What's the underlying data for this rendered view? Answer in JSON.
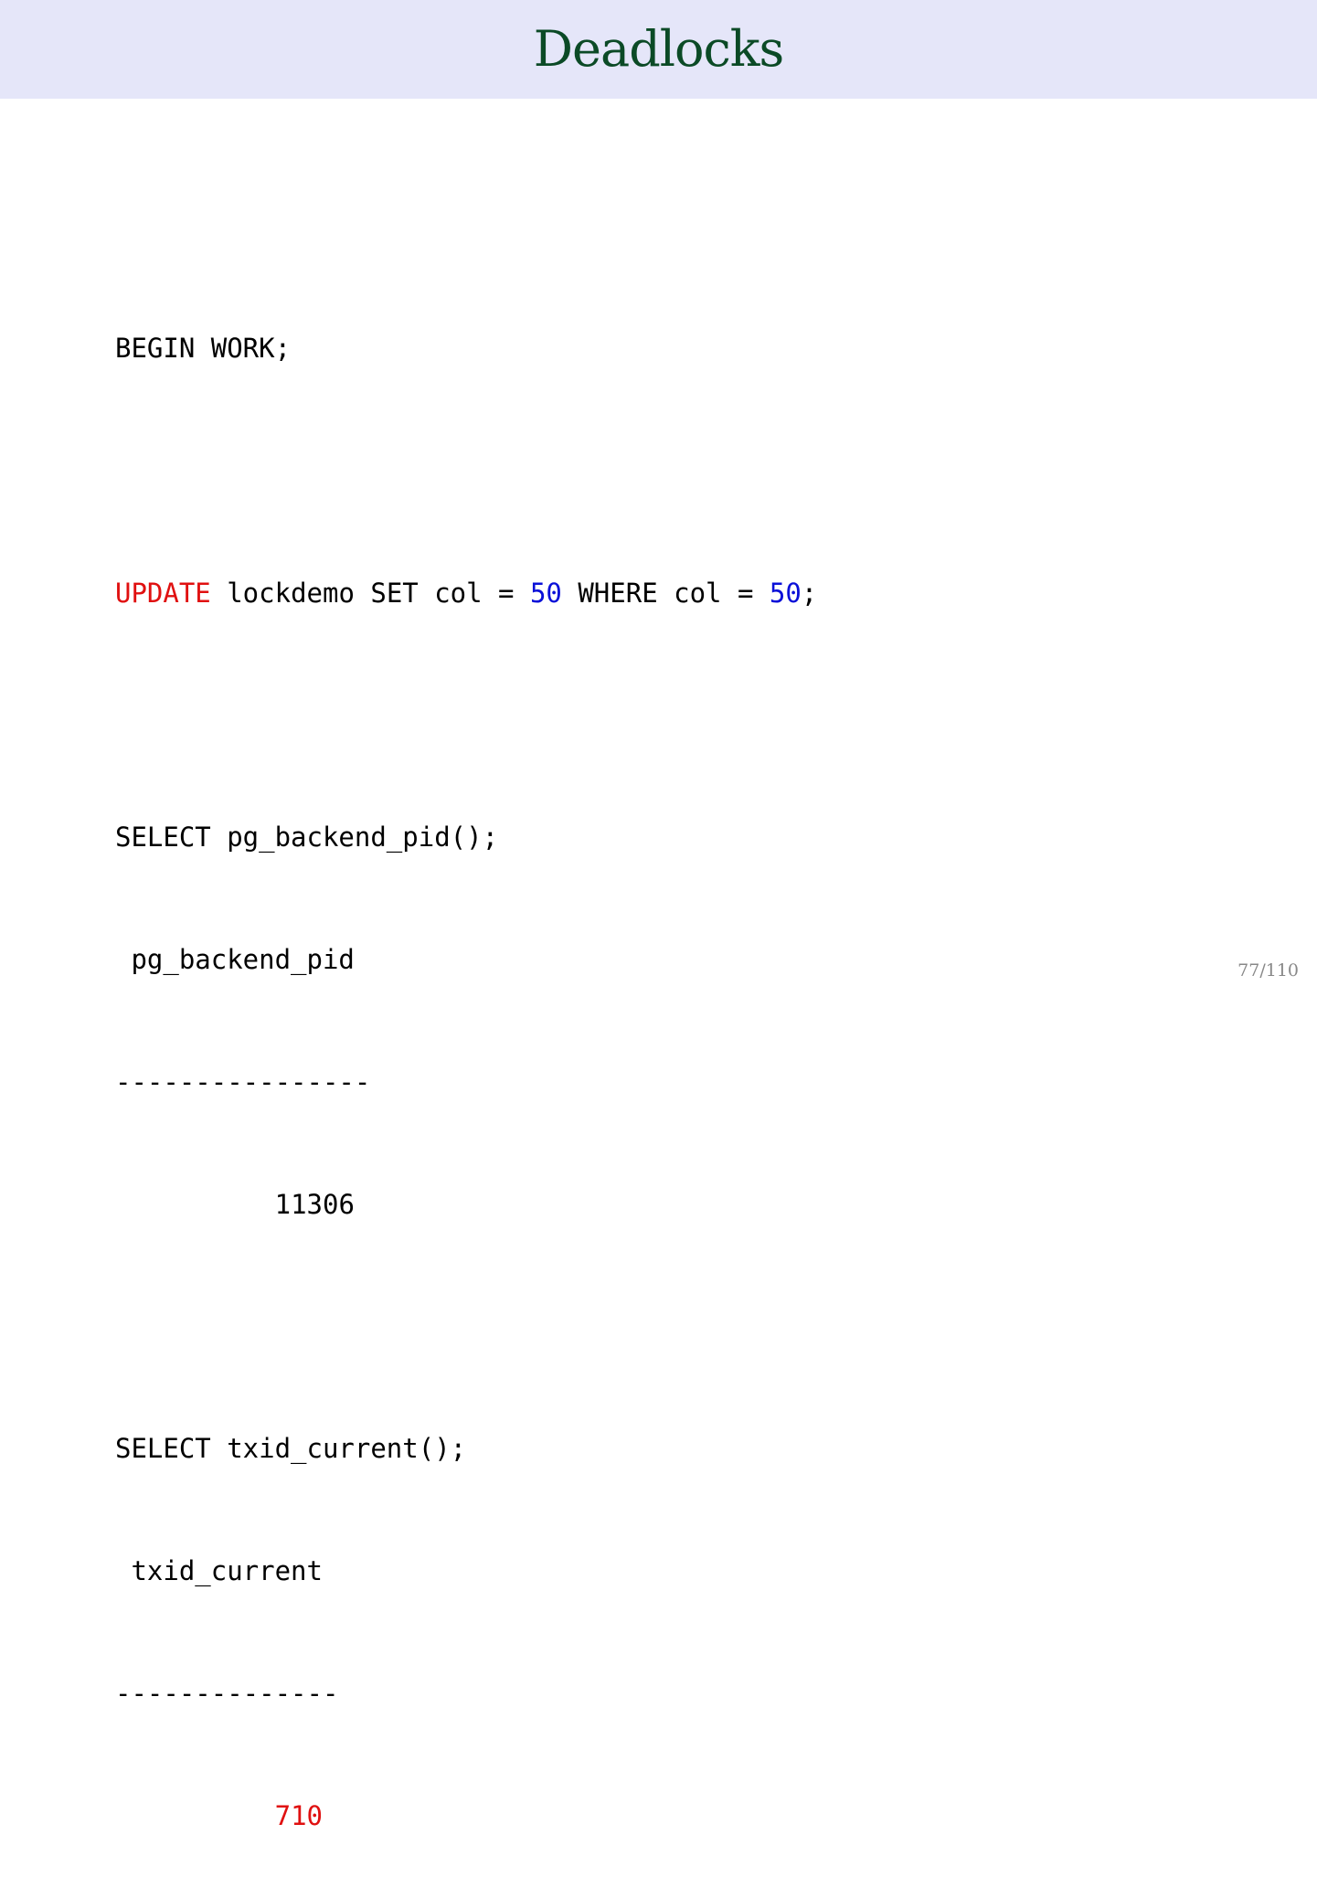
{
  "slide": {
    "title": "Deadlocks",
    "page_number": "77/110",
    "colors": {
      "header_bg": "#e5e6f9",
      "title": "#0b4a26",
      "keyword": "#e01010",
      "number": "#0a10d8"
    }
  },
  "code": {
    "begin": "BEGIN WORK;",
    "update_kw": "UPDATE",
    "update_1": " lockdemo SET col = ",
    "update_num1": "50",
    "update_2": " WHERE col = ",
    "update_num2": "50",
    "update_end": ";",
    "select_pid": "SELECT pg_backend_pid();",
    "pid_header": " pg_backend_pid",
    "pid_sep": "----------------",
    "pid_value_indent": "          ",
    "pid_value": "11306",
    "select_txid": "SELECT txid_current();",
    "txid_header": " txid_current",
    "txid_sep": "--------------",
    "txid_value_indent": "          ",
    "txid_value": "710"
  }
}
